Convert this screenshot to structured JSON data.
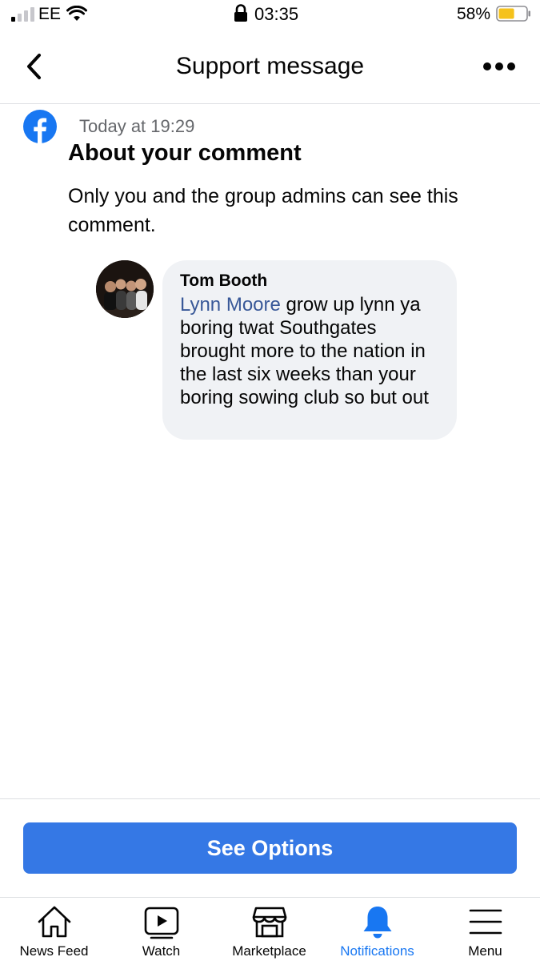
{
  "status_bar": {
    "carrier": "EE",
    "time": "03:35",
    "battery_percent": "58%",
    "battery_level": 0.58,
    "icons": [
      "signal-icon",
      "wifi-icon",
      "lock-icon",
      "battery-icon"
    ]
  },
  "header": {
    "title": "Support message",
    "back_icon": "chevron-left-icon",
    "more_icon": "more-dots-icon"
  },
  "message": {
    "timestamp": "Today at 19:29",
    "title": "About your comment",
    "body": "Only you and the group admins can see this comment."
  },
  "comment": {
    "author": "Tom Booth",
    "mention": "Lynn Moore",
    "text": " grow up lynn ya boring twat Southgates brought more to the nation in the last six weeks than your boring sowing club so but out"
  },
  "actions": {
    "see_options_label": "See Options"
  },
  "colors": {
    "accent": "#3578e5",
    "mention": "#385898",
    "active_tab": "#1877f2",
    "bubble_bg": "#f0f2f5"
  },
  "tab_bar": {
    "tabs": [
      {
        "label": "News Feed",
        "icon": "home-icon",
        "active": false
      },
      {
        "label": "Watch",
        "icon": "video-icon",
        "active": false
      },
      {
        "label": "Marketplace",
        "icon": "marketplace-icon",
        "active": false
      },
      {
        "label": "Notifications",
        "icon": "bell-icon",
        "active": true
      },
      {
        "label": "Menu",
        "icon": "hamburger-icon",
        "active": false
      }
    ]
  }
}
